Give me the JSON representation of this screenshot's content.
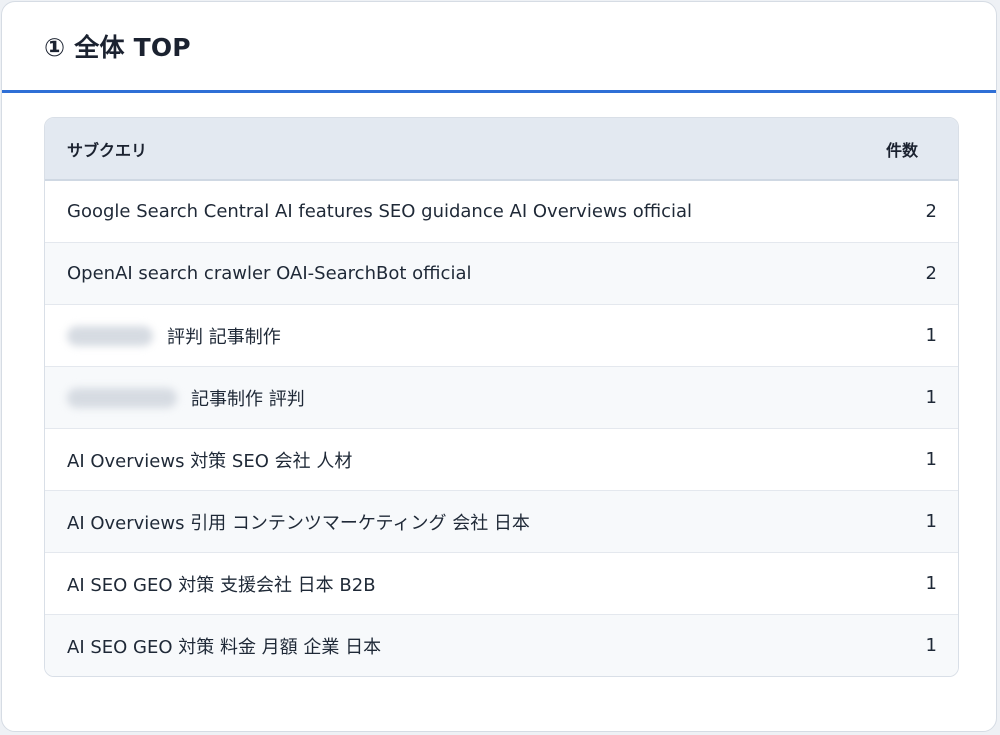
{
  "section": {
    "title": "① 全体 TOP"
  },
  "table": {
    "headers": {
      "query": "サブクエリ",
      "count": "件数"
    },
    "rows": [
      {
        "query": "Google Search Central AI features SEO guidance AI Overviews official",
        "count": "2"
      },
      {
        "query": "OpenAI search crawler OAI-SearchBot official",
        "count": "2"
      },
      {
        "query": "評判 記事制作",
        "count": "1",
        "redacted_prefix": true
      },
      {
        "query": "記事制作 評判",
        "count": "1",
        "redacted_prefix": true
      },
      {
        "query": "AI Overviews 対策 SEO 会社 人材",
        "count": "1"
      },
      {
        "query": "AI Overviews 引用 コンテンツマーケティング 会社 日本",
        "count": "1"
      },
      {
        "query": "AI SEO GEO 対策 支援会社 日本 B2B",
        "count": "1"
      },
      {
        "query": "AI SEO GEO 対策 料金 月額 企業 日本",
        "count": "1"
      }
    ]
  },
  "colors": {
    "accent": "#2f6fd6",
    "header_bg": "#e3e9f1"
  }
}
